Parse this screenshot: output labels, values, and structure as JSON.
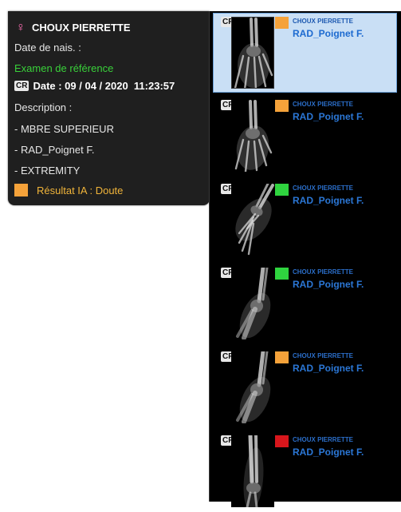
{
  "colors": {
    "orange": "#f5a23a",
    "green": "#2fd43f",
    "red": "#d8161c",
    "reference_green": "#39d13a",
    "result_text": "#f0b43a",
    "series_blue": "#2b77d6"
  },
  "info_panel": {
    "icon": "female-icon",
    "patient_name": "CHOUX PIERRETTE",
    "dob_label": "Date de nais. :",
    "reference_label": "Examen de référence",
    "modality": "CR",
    "date_text": "Date : 09 / 04 / 2020  11:23:57",
    "description_label": "Description :",
    "description_lines": [
      "- MBRE SUPERIEUR",
      "- RAD_Poignet F.",
      "- EXTREMITY"
    ],
    "ai_result_text": "Résultat IA : Doute",
    "ai_result_color": "#f5a23a"
  },
  "series": [
    {
      "modality": "CR",
      "patient": "CHOUX PIERRETTE",
      "name": "RAD_Poignet F.",
      "status_color": "#f5a23a",
      "selected": true,
      "view": "hand-pa"
    },
    {
      "modality": "CR",
      "patient": "CHOUX PIERRETTE",
      "name": "RAD_Poignet F.",
      "status_color": "#f5a23a",
      "selected": false,
      "view": "hand-oblique"
    },
    {
      "modality": "CR",
      "patient": "CHOUX PIERRETTE",
      "name": "RAD_Poignet F.",
      "status_color": "#2fd43f",
      "selected": false,
      "view": "hand-tilted"
    },
    {
      "modality": "CR",
      "patient": "CHOUX PIERRETTE",
      "name": "RAD_Poignet F.",
      "status_color": "#2fd43f",
      "selected": false,
      "view": "wrist-lateral"
    },
    {
      "modality": "CR",
      "patient": "CHOUX PIERRETTE",
      "name": "RAD_Poignet F.",
      "status_color": "#f5a23a",
      "selected": false,
      "view": "wrist-lateral-2"
    },
    {
      "modality": "CR",
      "patient": "CHOUX PIERRETTE",
      "name": "RAD_Poignet F.",
      "status_color": "#d8161c",
      "selected": false,
      "view": "forearm-wrist"
    }
  ]
}
